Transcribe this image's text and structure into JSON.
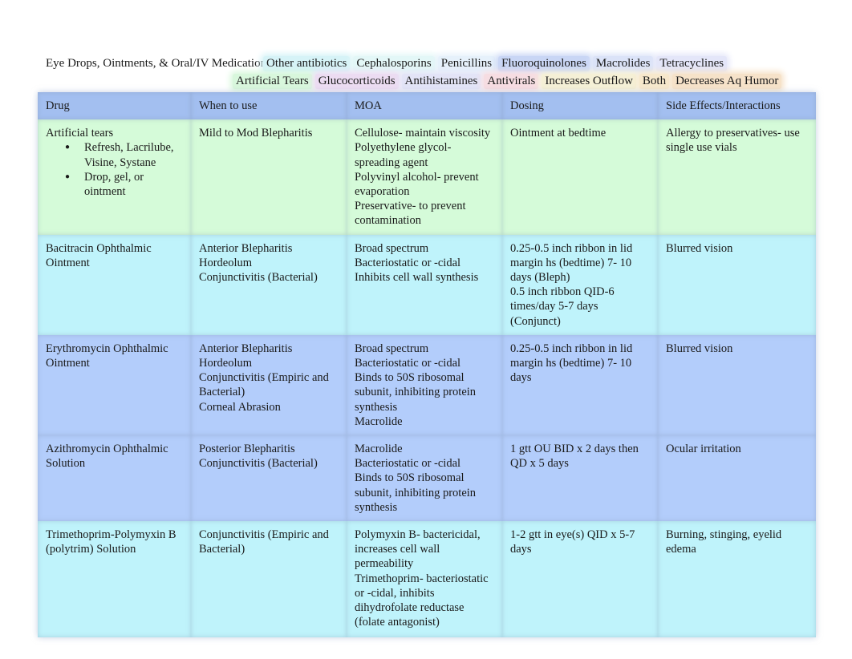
{
  "title": "Eye Drops, Ointments, & Oral/IV Medications",
  "legend": {
    "row1": [
      {
        "label": "Other antibiotics",
        "color": "#d6f3f7"
      },
      {
        "label": "Cephalosporins",
        "color": "#e3f7f7"
      },
      {
        "label": "Penicillins",
        "color": "#e6f1fb"
      },
      {
        "label": "Fluoroquinolones",
        "color": "#c9d6f5"
      },
      {
        "label": "Macrolides",
        "color": "#dbe3f8"
      },
      {
        "label": "Tetracyclines",
        "color": "#e4e6f9"
      }
    ],
    "row2": [
      {
        "label": "Artificial Tears",
        "color": "#d8f7dc"
      },
      {
        "label": "Glucocorticoids",
        "color": "#ecdcf2"
      },
      {
        "label": "Antihistamines",
        "color": "#e3e4f7"
      },
      {
        "label": "Antivirals",
        "color": "#f6dde2"
      },
      {
        "label": "Increases Outflow",
        "color": "#f5f0d6"
      },
      {
        "label": "Both",
        "color": "#f7e8cc"
      },
      {
        "label": "Decreases Aq Humor",
        "color": "#f6e2c9"
      }
    ]
  },
  "colors": {
    "header": "#a3bff0",
    "artificial_tears": "#d5fbd9",
    "other_antibiotics": "#bff3fb",
    "macrolides": "#b3cdfb"
  },
  "table": {
    "headers": [
      "Drug",
      "When to use",
      "MOA",
      "Dosing",
      "Side Effects/Interactions"
    ],
    "rows": [
      {
        "color_key": "artificial_tears",
        "drug": "Artificial tears",
        "drug_bullets": [
          "Refresh, Lacrilube, Visine, Systane",
          "Drop, gel, or ointment"
        ],
        "when": [
          "Mild to Mod Blepharitis"
        ],
        "moa": [
          "Cellulose- maintain viscosity",
          "Polyethylene glycol- spreading agent",
          "Polyvinyl alcohol- prevent evaporation",
          "Preservative- to prevent contamination"
        ],
        "dosing": [
          "Ointment at bedtime"
        ],
        "side": [
          "Allergy to preservatives- use single use vials"
        ]
      },
      {
        "color_key": "other_antibiotics",
        "drug": "Bacitracin Ophthalmic Ointment",
        "drug_bullets": [],
        "when": [
          "Anterior Blepharitis",
          "Hordeolum",
          "Conjunctivitis (Bacterial)"
        ],
        "moa": [
          "Broad spectrum",
          "Bacteriostatic or -cidal",
          "Inhibits cell wall synthesis"
        ],
        "dosing": [
          "0.25-0.5 inch ribbon in lid margin hs (bedtime) 7- 10 days (Bleph)",
          "0.5 inch ribbon QID-6 times/day 5-7 days (Conjunct)"
        ],
        "side": [
          "Blurred vision"
        ]
      },
      {
        "color_key": "macrolides",
        "drug": "Erythromycin Ophthalmic Ointment",
        "drug_bullets": [],
        "when": [
          "Anterior Blepharitis",
          "Hordeolum",
          "Conjunctivitis (Empiric and Bacterial)",
          "Corneal Abrasion"
        ],
        "moa": [
          "Broad spectrum",
          "Bacteriostatic or -cidal",
          "Binds to 50S ribosomal subunit, inhibiting protein synthesis",
          "Macrolide"
        ],
        "dosing": [
          "0.25-0.5 inch ribbon in lid margin hs (bedtime) 7- 10 days"
        ],
        "side": [
          "Blurred vision"
        ]
      },
      {
        "color_key": "macrolides",
        "drug": "Azithromycin Ophthalmic Solution",
        "drug_bullets": [],
        "when": [
          "Posterior Blepharitis",
          "Conjunctivitis (Bacterial)"
        ],
        "moa": [
          "Macrolide",
          "Bacteriostatic or -cidal",
          "Binds to 50S ribosomal subunit, inhibiting protein synthesis"
        ],
        "dosing": [
          "1 gtt OU BID x 2 days then QD x 5 days"
        ],
        "side": [
          "Ocular irritation"
        ]
      },
      {
        "color_key": "other_antibiotics",
        "drug": "Trimethoprim-Polymyxin B (polytrim) Solution",
        "drug_bullets": [],
        "when": [
          "Conjunctivitis (Empiric and Bacterial)"
        ],
        "moa": [
          "Polymyxin B- bactericidal, increases cell wall permeability",
          "Trimethoprim- bacteriostatic or -cidal, inhibits dihydrofolate reductase (folate antagonist)"
        ],
        "dosing": [
          "1-2 gtt in eye(s) QID x 5-7 days"
        ],
        "side": [
          "Burning, stinging, eyelid edema"
        ]
      }
    ]
  }
}
